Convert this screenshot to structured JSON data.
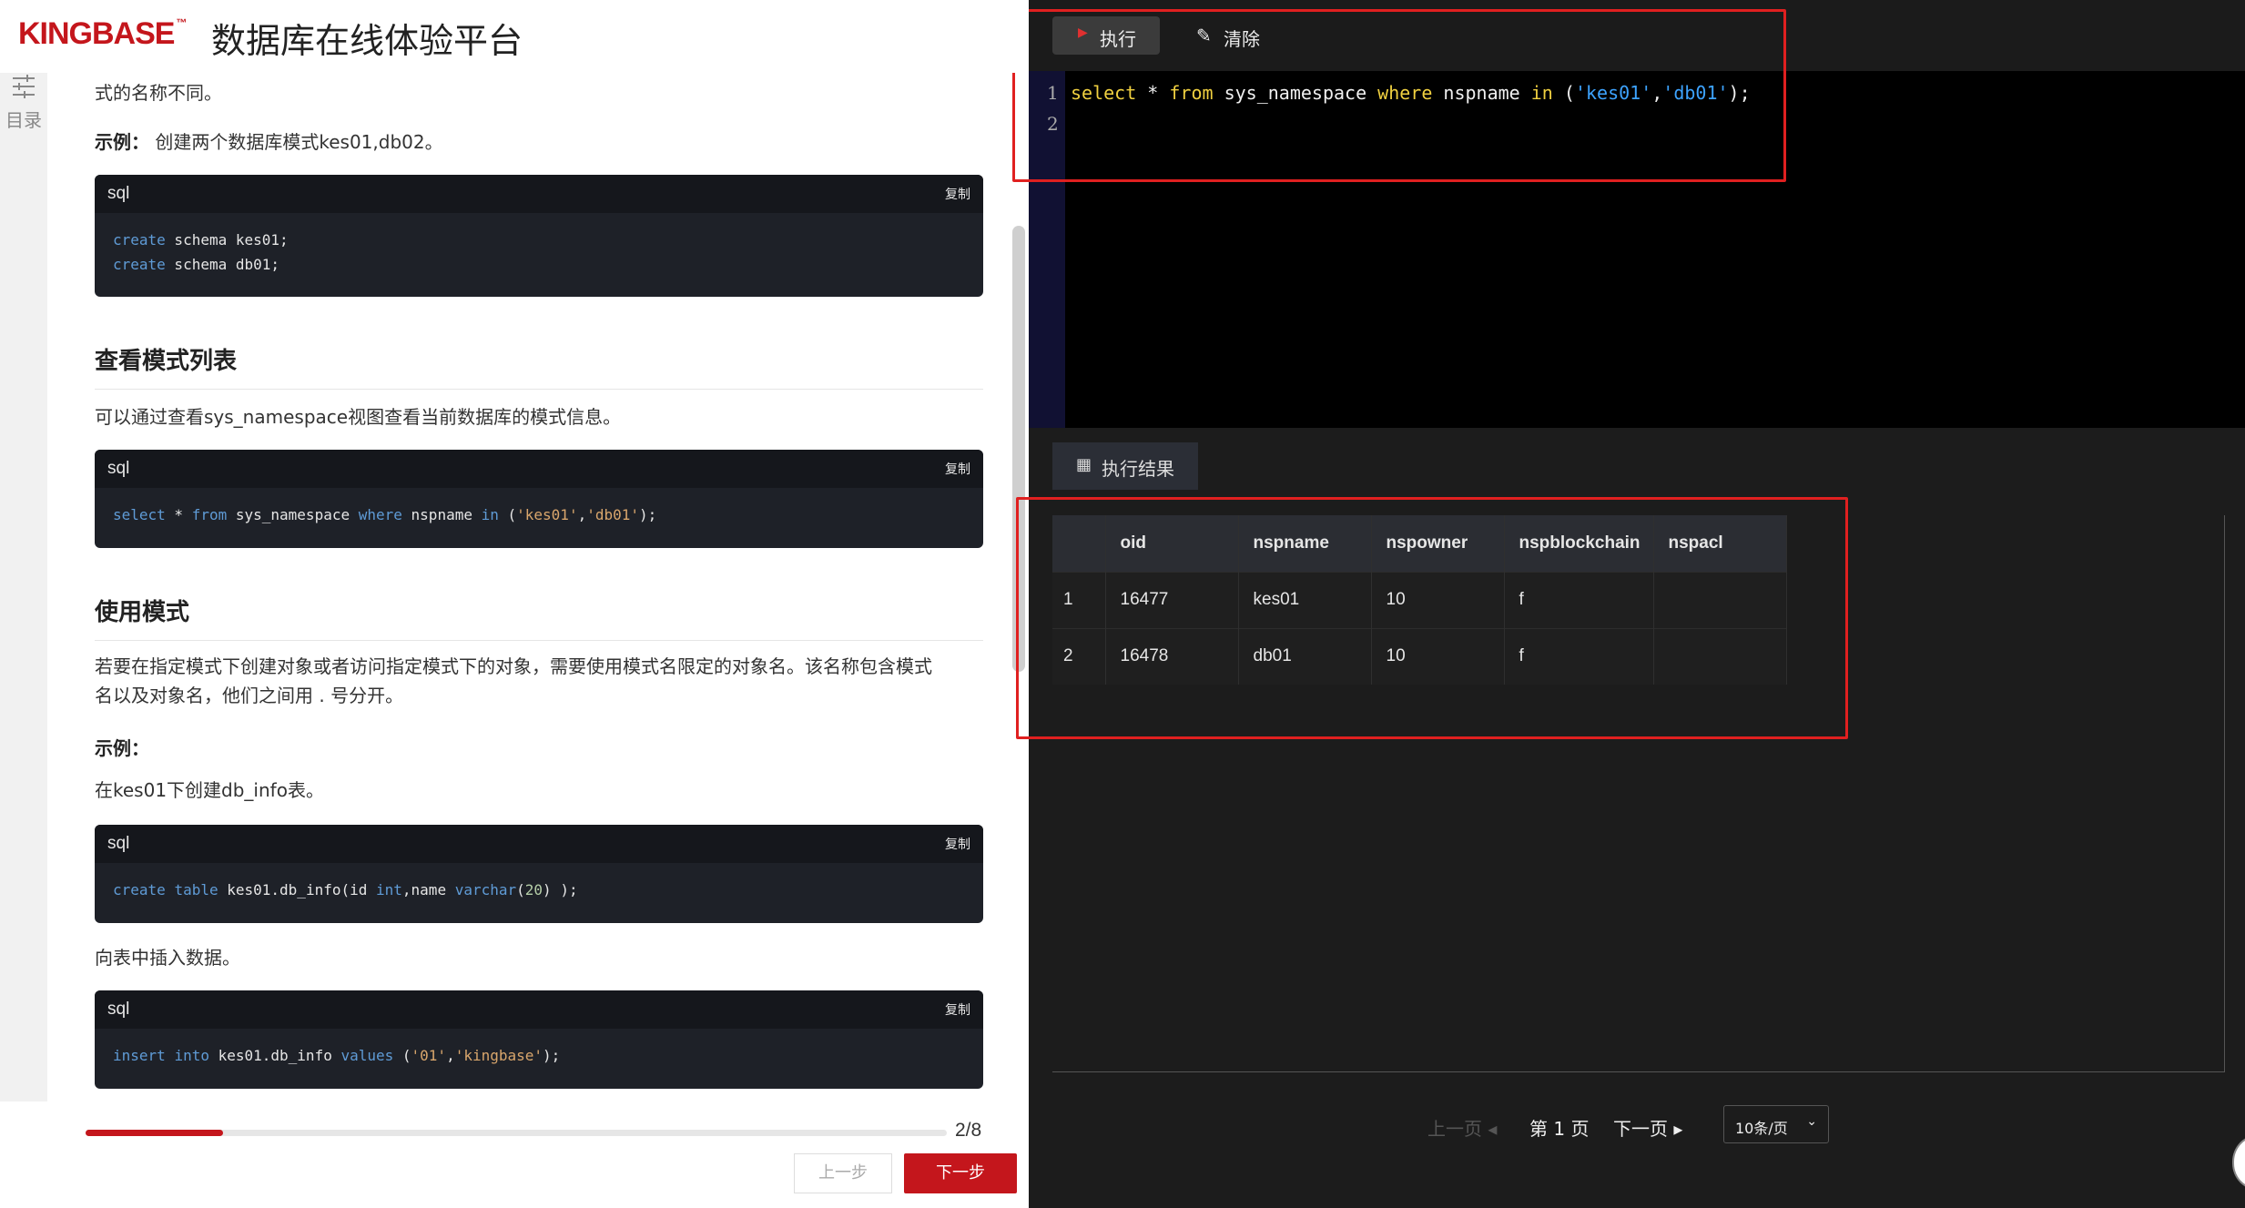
{
  "header": {
    "logo": "KINGBASE",
    "logo_tm": "™",
    "platform_title": "数据库在线体验平台"
  },
  "toc": {
    "label": "目录",
    "icon": "sliders-icon"
  },
  "doc": {
    "intro_tail": "式的名称不同。",
    "example1_label": "示例：",
    "example1_text": "创建两个数据库模式kes01,db02。",
    "code1": {
      "lang": "sql",
      "copy": "复制",
      "lines": [
        [
          "create",
          " schema kes01;"
        ],
        [
          "create",
          " schema db01;"
        ]
      ]
    },
    "section_list_title": "查看模式列表",
    "section_list_text": "可以通过查看sys_namespace视图查看当前数据库的模式信息。",
    "code2": {
      "lang": "sql",
      "copy": "复制"
    },
    "section_use_title": "使用模式",
    "section_use_text1": "若要在指定模式下创建对象或者访问指定模式下的对象，需要使用模式名限定的对象名。该名称包含模式",
    "section_use_text2": "名以及对象名，他们之间用 . 号分开。",
    "example2_label": "示例：",
    "example2_text": "在kes01下创建db_info表。",
    "code3": {
      "lang": "sql",
      "copy": "复制"
    },
    "insert_text": "向表中插入数据。",
    "code4": {
      "lang": "sql",
      "copy": "复制"
    }
  },
  "footer": {
    "progress": 0.16,
    "progress_label": "2/8",
    "prev_step": "上一步",
    "next_step": "下一步"
  },
  "toolbar": {
    "execute_label": "执行",
    "execute_icon": "run-icon",
    "clear_label": "清除",
    "clear_icon": "eraser-icon"
  },
  "editor": {
    "line_numbers": [
      "1",
      "2"
    ]
  },
  "results": {
    "tab_label": "执行结果",
    "tab_icon": "grid-icon",
    "columns": [
      "",
      "oid",
      "nspname",
      "nspowner",
      "nspblockchain",
      "nspacl"
    ],
    "rows": [
      [
        "1",
        "16477",
        "kes01",
        "10",
        "f",
        ""
      ],
      [
        "2",
        "16478",
        "db01",
        "10",
        "f",
        ""
      ]
    ]
  },
  "pager": {
    "prev": "上一页",
    "current": "第 1 页",
    "next": "下一页",
    "page_size": "10条/页"
  },
  "colors": {
    "brand_red": "#c4161c",
    "annotation_red": "#e02020",
    "editor_keyword": "#f0d040",
    "editor_string": "#3da3ff"
  }
}
